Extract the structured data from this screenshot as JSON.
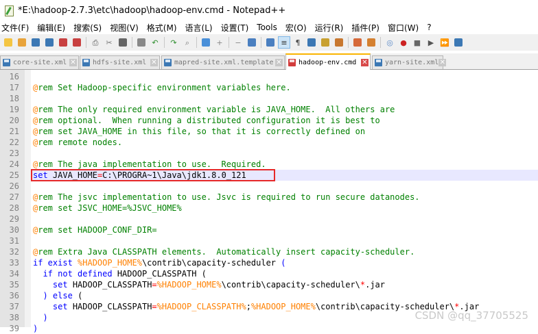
{
  "window": {
    "title": "*E:\\hadoop-2.7.3\\etc\\hadoop\\hadoop-env.cmd - Notepad++"
  },
  "menu": [
    "文件(F)",
    "编辑(E)",
    "搜索(S)",
    "视图(V)",
    "格式(M)",
    "语言(L)",
    "设置(T)",
    "Tools",
    "宏(O)",
    "运行(R)",
    "插件(P)",
    "窗口(W)",
    "?"
  ],
  "toolbar": {
    "icons": [
      "new-file-icon",
      "open-file-icon",
      "save-icon",
      "save-all-icon",
      "close-icon",
      "close-all-icon",
      "print-icon",
      "cut-icon",
      "copy-icon",
      "paste-icon",
      "undo-icon",
      "redo-icon",
      "find-icon",
      "replace-icon",
      "zoom-in-icon",
      "zoom-out-icon",
      "sync-vertical-icon",
      "sync-horizontal-icon",
      "word-wrap-icon",
      "show-all-chars-icon",
      "indent-guide-icon",
      "user-lang-icon",
      "doc-map-icon",
      "function-list-icon",
      "folder-workspace-icon",
      "monitor-icon",
      "record-macro-icon",
      "stop-record-icon",
      "play-macro-icon",
      "play-multiple-icon",
      "save-macro-icon"
    ]
  },
  "tabs": [
    {
      "label": "core-site.xml",
      "active": false
    },
    {
      "label": "hdfs-site.xml",
      "active": false
    },
    {
      "label": "mapred-site.xml.template",
      "active": false
    },
    {
      "label": "hadoop-env.cmd",
      "active": true
    },
    {
      "label": "yarn-site.xml",
      "active": false
    }
  ],
  "editor": {
    "lines": [
      {
        "n": "16",
        "tokens": []
      },
      {
        "n": "17",
        "tokens": [
          [
            "at",
            "@"
          ],
          [
            "rem",
            "rem Set Hadoop-specific environment variables here."
          ]
        ]
      },
      {
        "n": "18",
        "tokens": []
      },
      {
        "n": "19",
        "tokens": [
          [
            "at",
            "@"
          ],
          [
            "rem",
            "rem The only required environment variable is JAVA_HOME.  All others are"
          ]
        ]
      },
      {
        "n": "20",
        "tokens": [
          [
            "at",
            "@"
          ],
          [
            "rem",
            "rem optional.  When running a distributed configuration it is best to"
          ]
        ]
      },
      {
        "n": "21",
        "tokens": [
          [
            "at",
            "@"
          ],
          [
            "rem",
            "rem set JAVA_HOME in this file, so that it is correctly defined on"
          ]
        ]
      },
      {
        "n": "22",
        "tokens": [
          [
            "at",
            "@"
          ],
          [
            "rem",
            "rem remote nodes."
          ]
        ]
      },
      {
        "n": "23",
        "tokens": []
      },
      {
        "n": "24",
        "tokens": [
          [
            "at",
            "@"
          ],
          [
            "rem",
            "rem The java implementation to use.  Required."
          ]
        ]
      },
      {
        "n": "25",
        "tokens": [
          [
            "kw",
            "set"
          ],
          [
            "plain",
            " JAVA_HOME"
          ],
          [
            "op",
            "="
          ],
          [
            "plain",
            "C:\\PROGRA~1\\Java\\jdk1.8.0_121"
          ]
        ]
      },
      {
        "n": "26",
        "tokens": []
      },
      {
        "n": "27",
        "tokens": [
          [
            "at",
            "@"
          ],
          [
            "rem",
            "rem The jsvc implementation to use. Jsvc is required to run secure datanodes."
          ]
        ]
      },
      {
        "n": "28",
        "tokens": [
          [
            "at",
            "@"
          ],
          [
            "rem",
            "rem set JSVC_HOME=%JSVC_HOME%"
          ]
        ]
      },
      {
        "n": "29",
        "tokens": []
      },
      {
        "n": "30",
        "tokens": [
          [
            "at",
            "@"
          ],
          [
            "rem",
            "rem set HADOOP_CONF_DIR="
          ]
        ]
      },
      {
        "n": "31",
        "tokens": []
      },
      {
        "n": "32",
        "tokens": [
          [
            "at",
            "@"
          ],
          [
            "rem",
            "rem Extra Java CLASSPATH elements.  Automatically insert capacity-scheduler."
          ]
        ]
      },
      {
        "n": "33",
        "tokens": [
          [
            "kw",
            "if exist"
          ],
          [
            "plain",
            " "
          ],
          [
            "var",
            "%HADOOP_HOME%"
          ],
          [
            "plain",
            "\\contrib\\capacity-scheduler "
          ],
          [
            "blue",
            "("
          ]
        ]
      },
      {
        "n": "34",
        "tokens": [
          [
            "plain",
            "  "
          ],
          [
            "kw",
            "if not defined"
          ],
          [
            "plain",
            " HADOOP_CLASSPATH "
          ],
          [
            "plain",
            "("
          ]
        ]
      },
      {
        "n": "35",
        "tokens": [
          [
            "plain",
            "    "
          ],
          [
            "kw",
            "set"
          ],
          [
            "plain",
            " HADOOP_CLASSPATH"
          ],
          [
            "op",
            "="
          ],
          [
            "var",
            "%HADOOP_HOME%"
          ],
          [
            "plain",
            "\\contrib\\capacity-scheduler\\"
          ],
          [
            "op",
            "*"
          ],
          [
            "plain",
            ".jar"
          ]
        ]
      },
      {
        "n": "36",
        "tokens": [
          [
            "plain",
            "  "
          ],
          [
            "blue",
            ")"
          ],
          [
            "plain",
            " "
          ],
          [
            "kw",
            "else"
          ],
          [
            "plain",
            " "
          ],
          [
            "plain",
            "("
          ]
        ]
      },
      {
        "n": "37",
        "tokens": [
          [
            "plain",
            "    "
          ],
          [
            "kw",
            "set"
          ],
          [
            "plain",
            " HADOOP_CLASSPATH"
          ],
          [
            "op",
            "="
          ],
          [
            "var",
            "%HADOOP_CLASSPATH%"
          ],
          [
            "plain",
            ";"
          ],
          [
            "var",
            "%HADOOP_HOME%"
          ],
          [
            "plain",
            "\\contrib\\capacity-scheduler\\"
          ],
          [
            "op",
            "*"
          ],
          [
            "plain",
            ".jar"
          ]
        ]
      },
      {
        "n": "38",
        "tokens": [
          [
            "plain",
            "  "
          ],
          [
            "blue",
            ")"
          ]
        ]
      },
      {
        "n": "39",
        "tokens": [
          [
            "blue",
            ")"
          ]
        ]
      }
    ]
  },
  "watermark": "CSDN @qq_37705525"
}
